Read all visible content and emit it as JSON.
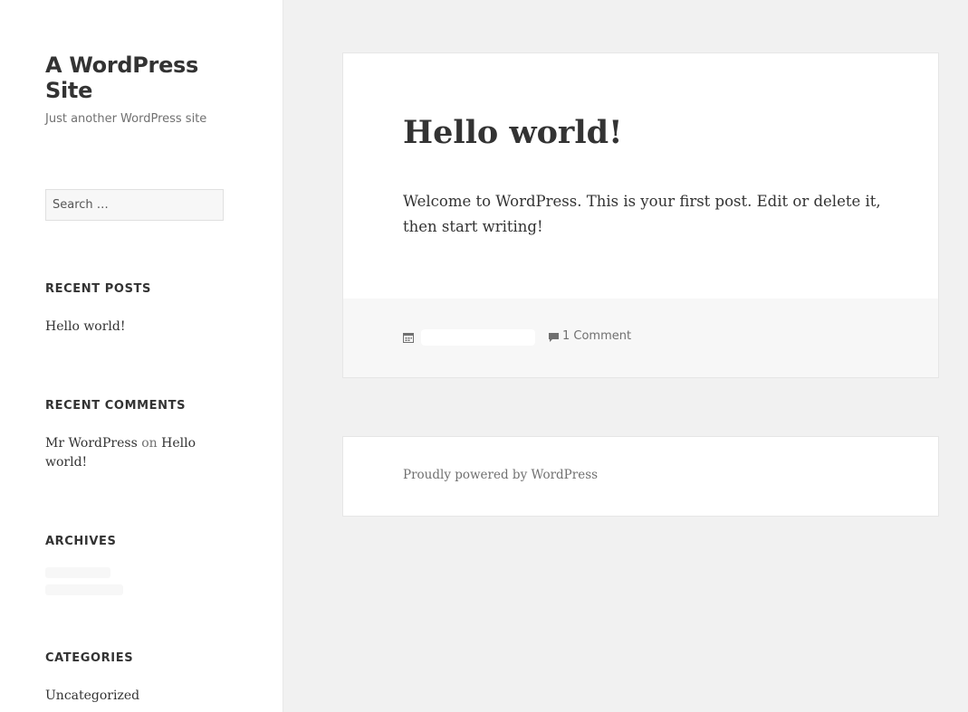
{
  "site": {
    "title": "A WordPress Site",
    "description": "Just another WordPress site"
  },
  "search": {
    "placeholder": "Search …"
  },
  "widgets": {
    "recent_posts": {
      "title": "RECENT POSTS",
      "items": [
        "Hello world!"
      ]
    },
    "recent_comments": {
      "title": "RECENT COMMENTS",
      "author": "Mr WordPress",
      "connector": "on",
      "post": "Hello world!"
    },
    "archives": {
      "title": "ARCHIVES"
    },
    "categories": {
      "title": "CATEGORIES",
      "items": [
        "Uncategorized"
      ]
    }
  },
  "post": {
    "title": "Hello world!",
    "body": "Welcome to WordPress. This is your first post. Edit or delete it, then start writing!",
    "comments_link": "1 Comment"
  },
  "footer": {
    "powered_by": "Proudly powered by WordPress"
  },
  "icons": {
    "date": "calendar-icon",
    "comments": "comment-bubble-icon"
  }
}
